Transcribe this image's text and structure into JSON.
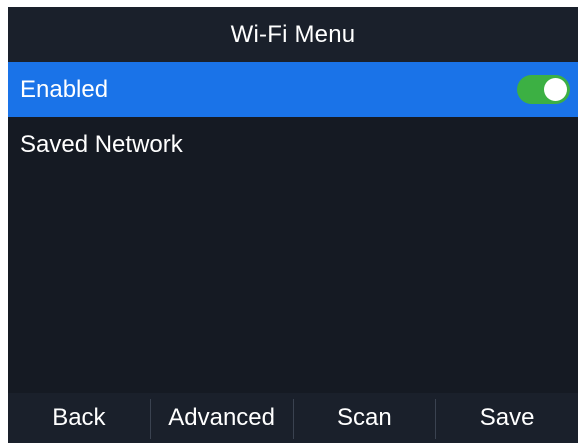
{
  "title": "Wi-Fi Menu",
  "menu": {
    "items": [
      {
        "label": "Enabled",
        "selected": true,
        "control": "toggle",
        "toggle_state": "on"
      },
      {
        "label": "Saved Network",
        "selected": false
      }
    ]
  },
  "softkeys": [
    "Back",
    "Advanced",
    "Scan",
    "Save"
  ],
  "colors": {
    "background": "#151a23",
    "bar_background": "#1a202b",
    "selection": "#1a73e8",
    "toggle_on": "#3cb043",
    "text": "#ffffff"
  }
}
